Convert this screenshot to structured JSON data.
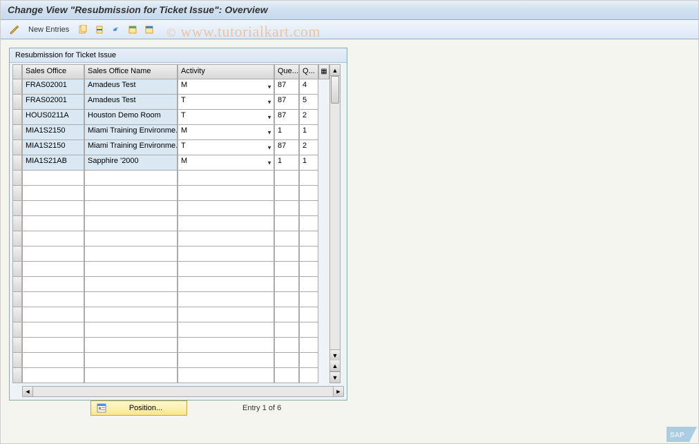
{
  "title": "Change View \"Resubmission for Ticket Issue\": Overview",
  "watermark": "www.tutorialkart.com",
  "toolbar": {
    "new_entries": "New Entries"
  },
  "panel": {
    "title": "Resubmission for Ticket Issue"
  },
  "columns": {
    "sales_office": "Sales Office",
    "sales_office_name": "Sales Office Name",
    "activity": "Activity",
    "que": "Que...",
    "q": "Q..."
  },
  "rows": [
    {
      "so": "FRAS02001",
      "name": "Amadeus Test",
      "act": "M",
      "que": "87",
      "q": "4"
    },
    {
      "so": "FRAS02001",
      "name": "Amadeus Test",
      "act": "T",
      "que": "87",
      "q": "5"
    },
    {
      "so": "HOUS0211A",
      "name": "Houston Demo Room",
      "act": "T",
      "que": "87",
      "q": "2"
    },
    {
      "so": "MIA1S2150",
      "name": "Miami Training Environme..",
      "act": "M",
      "que": "1",
      "q": "1"
    },
    {
      "so": "MIA1S2150",
      "name": "Miami Training Environme..",
      "act": "T",
      "que": "87",
      "q": "2"
    },
    {
      "so": "MIA1S21AB",
      "name": "Sapphire '2000",
      "act": "M",
      "que": "1",
      "q": "1"
    }
  ],
  "empty_rows": 14,
  "footer": {
    "position_btn": "Position...",
    "entry_text": "Entry 1 of 6"
  },
  "chart_data": {
    "type": "table",
    "title": "Resubmission for Ticket Issue",
    "columns": [
      "Sales Office",
      "Sales Office Name",
      "Activity",
      "Que...",
      "Q..."
    ],
    "rows": [
      [
        "FRAS02001",
        "Amadeus Test",
        "M",
        "87",
        "4"
      ],
      [
        "FRAS02001",
        "Amadeus Test",
        "T",
        "87",
        "5"
      ],
      [
        "HOUS0211A",
        "Houston Demo Room",
        "T",
        "87",
        "2"
      ],
      [
        "MIA1S2150",
        "Miami Training Environme..",
        "M",
        "1",
        "1"
      ],
      [
        "MIA1S2150",
        "Miami Training Environme..",
        "T",
        "87",
        "2"
      ],
      [
        "MIA1S21AB",
        "Sapphire '2000",
        "M",
        "1",
        "1"
      ]
    ]
  }
}
